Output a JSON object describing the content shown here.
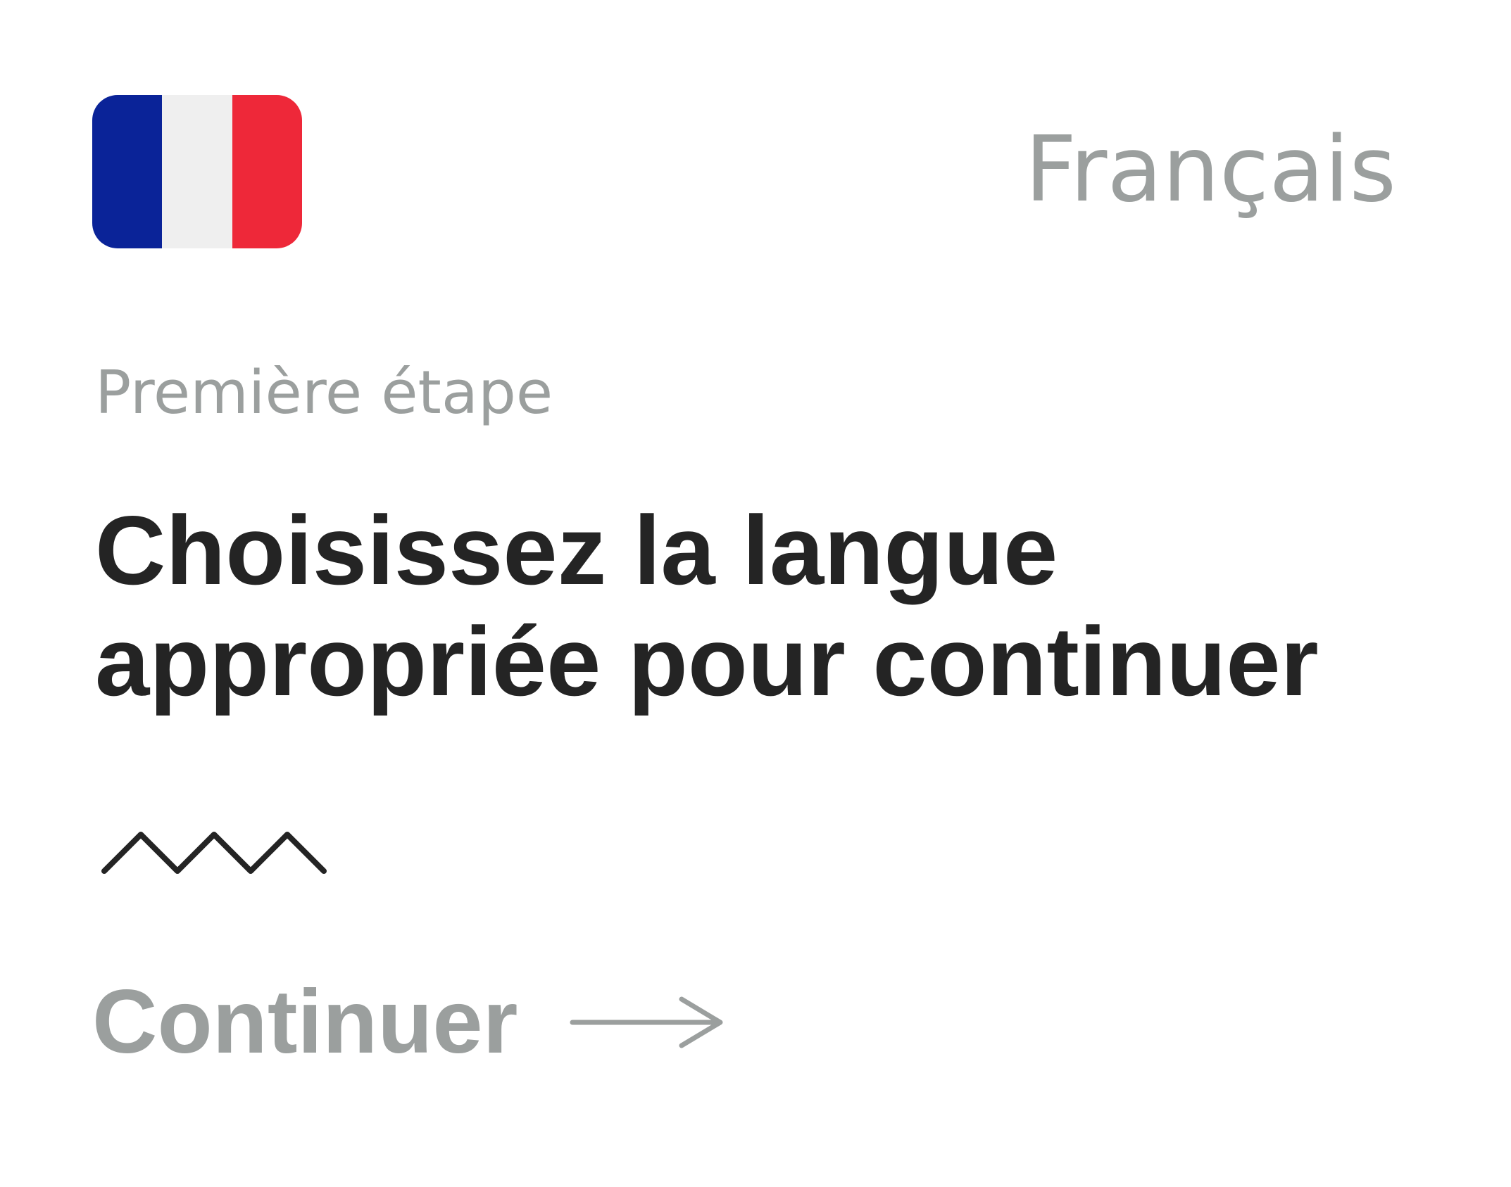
{
  "header": {
    "flag": {
      "icon": "france-flag-icon",
      "colors": [
        "#0a2398",
        "#efefef",
        "#ee2839"
      ]
    },
    "language_name": "Français"
  },
  "step": {
    "label": "Première étape"
  },
  "headline": {
    "line1": "Choisissez la langue",
    "line2": "appropriée pour continuer"
  },
  "decoration": {
    "icon": "zigzag-icon",
    "color": "#242424"
  },
  "action": {
    "continue_label": "Continuer",
    "arrow_icon": "arrow-right-icon",
    "color": "#9b9f9e"
  },
  "theme": {
    "text_dark": "#242424",
    "text_muted": "#9b9f9e",
    "background": "#ffffff"
  }
}
